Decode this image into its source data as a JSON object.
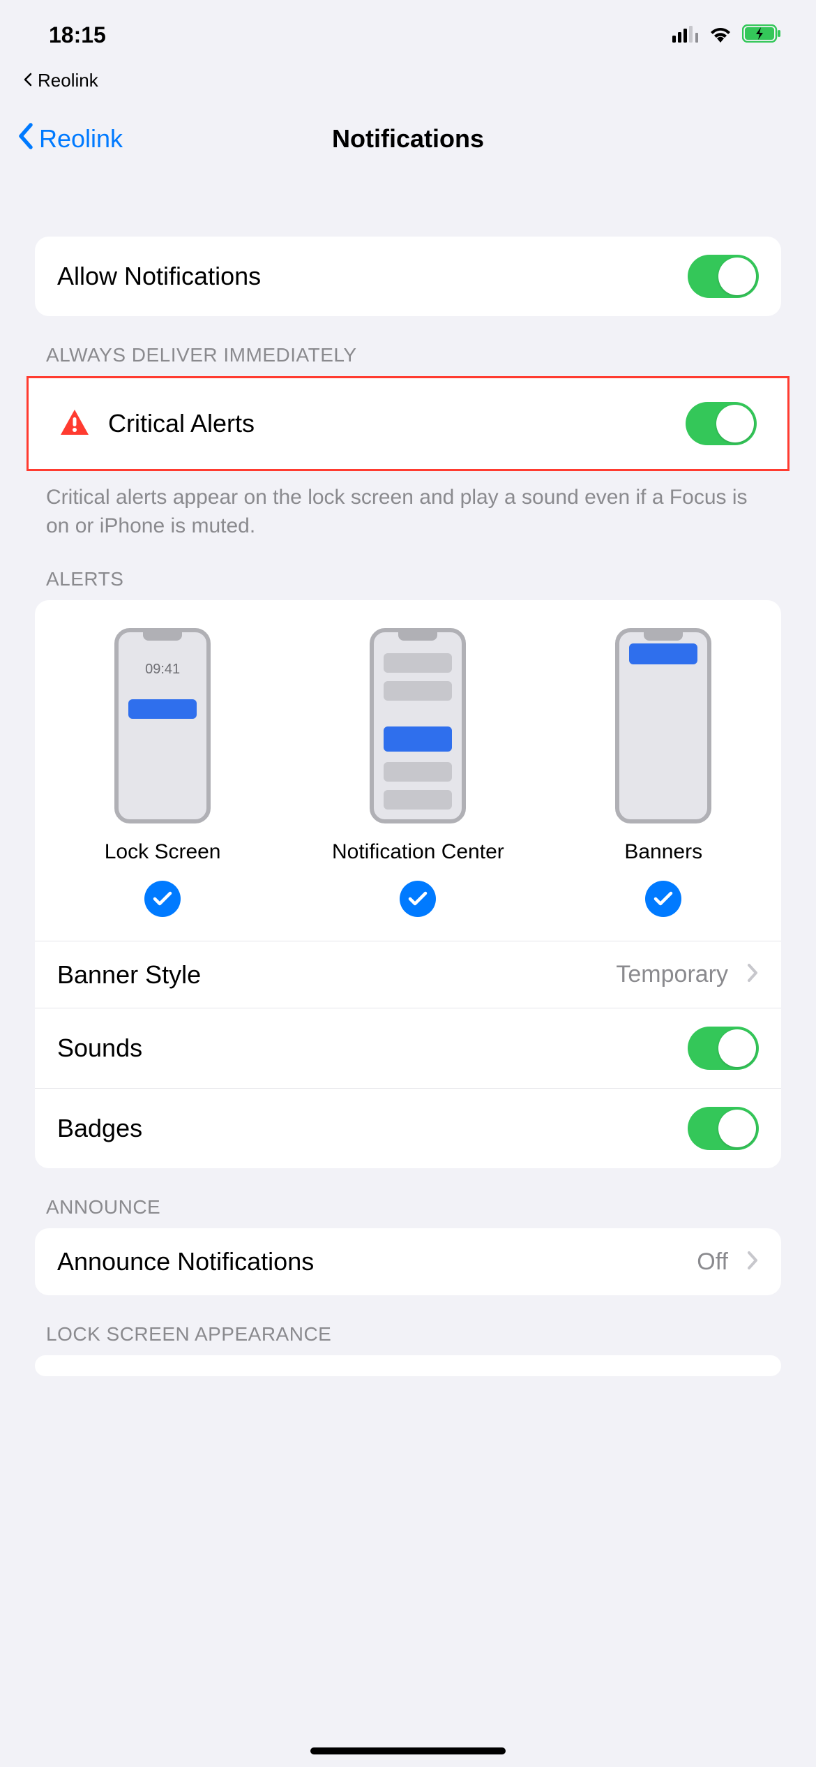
{
  "status": {
    "time": "18:15",
    "breadcrumb_app": "Reolink"
  },
  "nav": {
    "back_label": "Reolink",
    "title": "Notifications"
  },
  "allow": {
    "label": "Allow Notifications",
    "on": true
  },
  "critical": {
    "header": "Always Deliver Immediately",
    "label": "Critical Alerts",
    "on": true,
    "footer": "Critical alerts appear on the lock screen and play a sound even if a Focus is on or iPhone is muted."
  },
  "alerts": {
    "header": "Alerts",
    "styles": [
      {
        "label": "Lock Screen",
        "checked": true,
        "preview_time": "09:41"
      },
      {
        "label": "Notification Center",
        "checked": true
      },
      {
        "label": "Banners",
        "checked": true
      }
    ],
    "banner_style": {
      "label": "Banner Style",
      "value": "Temporary"
    },
    "sounds": {
      "label": "Sounds",
      "on": true
    },
    "badges": {
      "label": "Badges",
      "on": true
    }
  },
  "announce": {
    "header": "Announce",
    "label": "Announce Notifications",
    "value": "Off"
  },
  "appearance": {
    "header": "Lock Screen Appearance"
  }
}
